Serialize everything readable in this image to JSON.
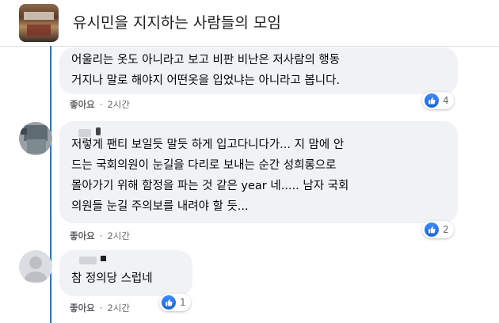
{
  "group": {
    "title": "유시민을 지지하는 사람들의 모임"
  },
  "comments": [
    {
      "lines": [
        "어울리는 옷도 아니라고 보고 비판 비난은 저사람의 행동",
        "거지나 말로 해야지 어떤옷을 입었냐는 아니라고 봅니다."
      ],
      "like_label": "좋아요",
      "separator": "·",
      "time": "2시간",
      "reaction_count": "4"
    },
    {
      "lines": [
        "저렇게 팬티 보일듯 말듯 하게 입고다니다가... 지 맘에 안",
        "드는 국회의원이 눈길을 다리로 보내는 순간 성희롱으로",
        "몰아가기 위해 함정을 파는 것 같은 year 네..... 남자 국회",
        "의원들 눈길 주의보를 내려야 할 듯..."
      ],
      "like_label": "좋아요",
      "separator": "·",
      "time": "2시간",
      "reaction_count": "2"
    },
    {
      "lines": [
        "참 정의당 스럽네"
      ],
      "like_label": "좋아요",
      "separator": "·",
      "time": "2시간",
      "reaction_count": "1"
    }
  ],
  "icons": {
    "reaction": "like-icon",
    "avatar_default": "default-avatar-icon"
  },
  "colors": {
    "accent": "#1877f2",
    "bubble": "#f0f2f5",
    "meta_text": "#65676b"
  }
}
